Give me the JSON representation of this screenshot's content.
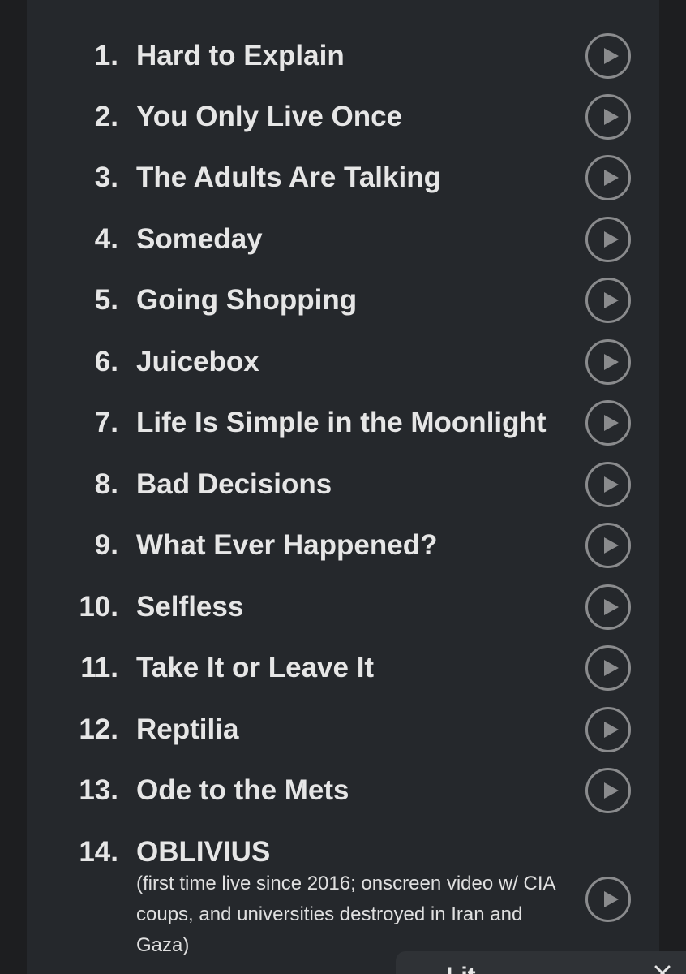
{
  "setlist": {
    "tracks": [
      {
        "number": "1.",
        "title": "Hard to Explain"
      },
      {
        "number": "2.",
        "title": "You Only Live Once"
      },
      {
        "number": "3.",
        "title": "The Adults Are Talking"
      },
      {
        "number": "4.",
        "title": "Someday"
      },
      {
        "number": "5.",
        "title": "Going Shopping"
      },
      {
        "number": "6.",
        "title": "Juicebox"
      },
      {
        "number": "7.",
        "title": "Life Is Simple in the Moonlight"
      },
      {
        "number": "8.",
        "title": "Bad Decisions"
      },
      {
        "number": "9.",
        "title": "What Ever Happened?"
      },
      {
        "number": "10.",
        "title": "Selfless"
      },
      {
        "number": "11.",
        "title": "Take It or Leave It"
      },
      {
        "number": "12.",
        "title": "Reptilia"
      },
      {
        "number": "13.",
        "title": "Ode to the Mets"
      },
      {
        "number": "14.",
        "title": "OBLIVIUS",
        "note": "(first time live since 2016; onscreen video w/ CIA coups, and universities destroyed in Iran and Gaza)"
      }
    ],
    "play_icon": "play-circle-icon"
  },
  "bottom_sheet": {
    "title": "Lit",
    "close_icon": "close-icon"
  },
  "colors": {
    "background": "#1d1e20",
    "panel": "#25282c",
    "text": "#e6e6e6",
    "icon": "#8a8b8d"
  }
}
